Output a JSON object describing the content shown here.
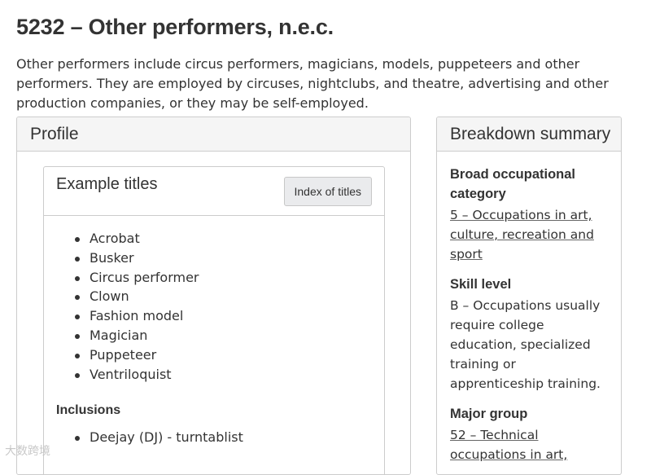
{
  "page": {
    "title": "5232 – Other performers, n.e.c.",
    "intro": "Other performers include circus performers, magicians, models, puppeteers and other performers. They are employed by circuses, nightclubs, and theatre, advertising and other production companies, or they may be self-employed."
  },
  "profile": {
    "heading": "Profile",
    "example_titles": {
      "heading": "Example titles",
      "index_button_label": "Index of titles",
      "items": [
        "Acrobat",
        "Busker",
        "Circus performer",
        "Clown",
        "Fashion model",
        "Magician",
        "Puppeteer",
        "Ventriloquist"
      ]
    },
    "inclusions": {
      "label": "Inclusions",
      "items": [
        "Deejay (DJ) - turntablist"
      ]
    }
  },
  "summary": {
    "heading": "Breakdown summary",
    "broad_category": {
      "label": "Broad occupational category",
      "value": "5 – Occupations in art, culture, recreation and sport"
    },
    "skill_level": {
      "label": "Skill level",
      "value": "B – Occupations usually require college education, specialized training or apprenticeship training."
    },
    "major_group": {
      "label": "Major group",
      "value": "52 – Technical occupations in art,"
    }
  },
  "watermark": "大数跨境"
}
